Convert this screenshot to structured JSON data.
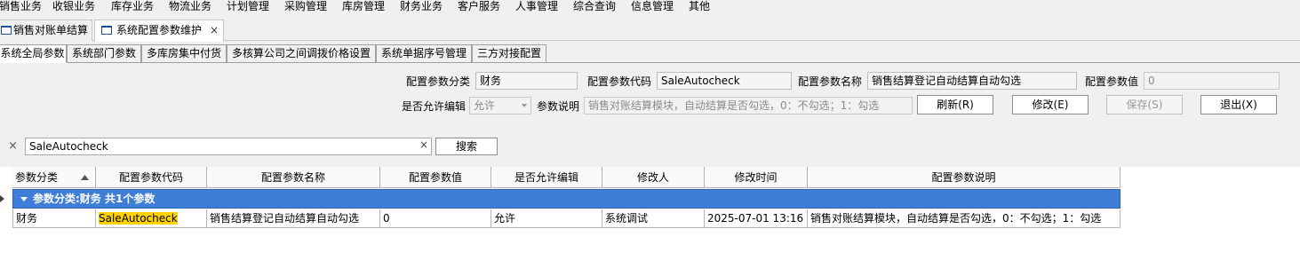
{
  "menu": [
    "销售业务",
    "收银业务",
    "库存业务",
    "物流业务",
    "计划管理",
    "采购管理",
    "库房管理",
    "财务业务",
    "客户服务",
    "人事管理",
    "综合查询",
    "信息管理",
    "其他"
  ],
  "doc_tabs": [
    {
      "label": "销售对账单结算"
    },
    {
      "label": "系统配置参数维护",
      "close": "×"
    }
  ],
  "sub_tabs": [
    "系统全局参数",
    "系统部门参数",
    "多库房集中付货",
    "多核算公司之间调拨价格设置",
    "系统单据序号管理",
    "三方对接配置"
  ],
  "form": {
    "category_label": "配置参数分类",
    "category_value": "财务",
    "code_label": "配置参数代码",
    "code_value": "SaleAutocheck",
    "name_label": "配置参数名称",
    "name_value": "销售结算登记自动结算自动勾选",
    "value_label": "配置参数值",
    "value_value": "0",
    "editable_label": "是否允许编辑",
    "editable_value": "允许",
    "desc_label": "参数说明",
    "desc_value": "销售对账结算模块，自动结算是否勾选，0：不勾选；1：勾选",
    "btn_refresh": "刷新(R)",
    "btn_modify": "修改(E)",
    "btn_save": "保存(S)",
    "btn_exit": "退出(X)"
  },
  "search": {
    "close": "×",
    "value": "SaleAutocheck",
    "clear": "×",
    "button": "搜索"
  },
  "grid": {
    "columns": [
      "参数分类",
      "配置参数代码",
      "配置参数名称",
      "配置参数值",
      "是否允许编辑",
      "修改人",
      "修改时间",
      "配置参数说明"
    ],
    "group_label": "参数分类:财务 共1个参数",
    "rows": [
      {
        "category": "财务",
        "code": "SaleAutocheck",
        "name": "销售结算登记自动结算自动勾选",
        "value": "0",
        "editable": "允许",
        "modifier": "系统调试",
        "modified_time": "2025-07-01 13:16",
        "description": "销售对账结算模块，自动结算是否勾选，0：不勾选；1：勾选"
      }
    ]
  },
  "colors": {
    "group_row_bg": "#3f7ed7",
    "search_highlight": "#ffd200",
    "icon_blue": "#1a4f9c"
  }
}
